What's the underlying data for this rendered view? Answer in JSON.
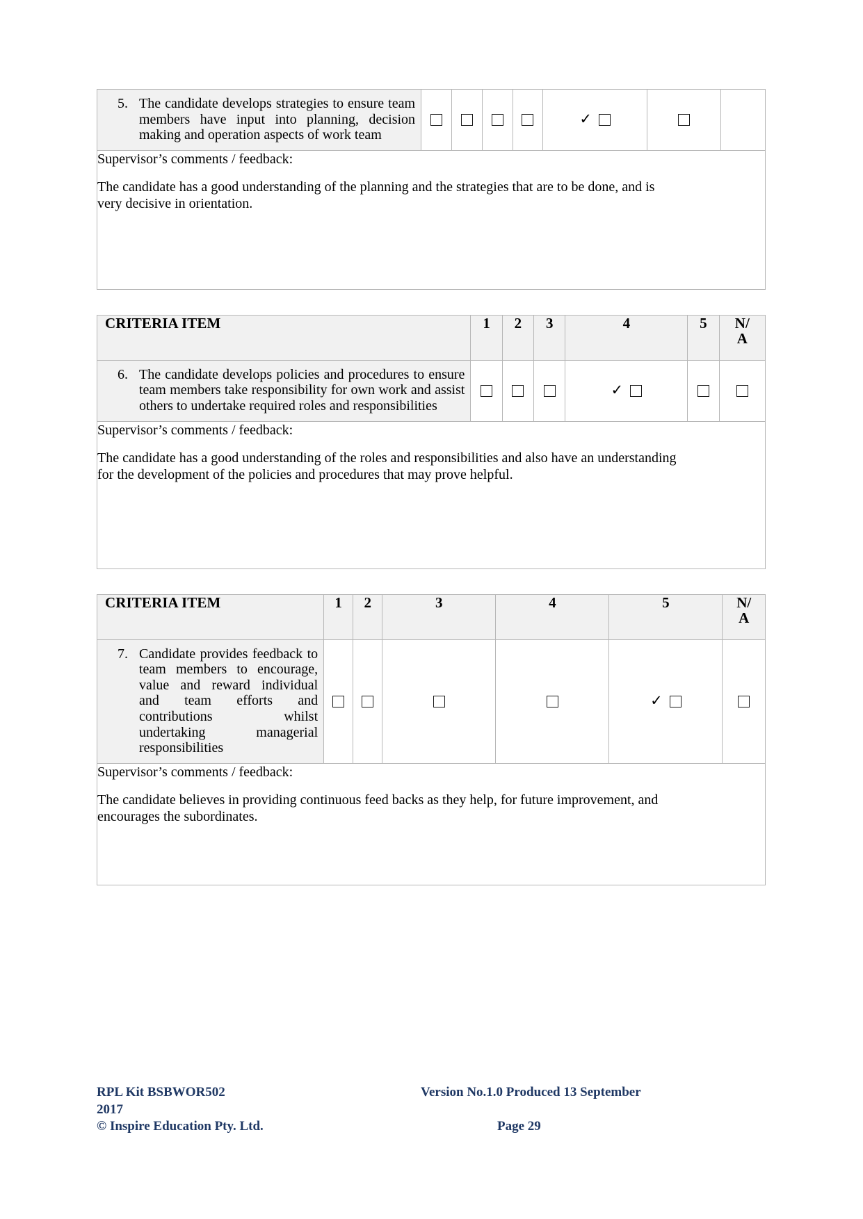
{
  "document": {
    "columns_header": {
      "criteria_label": "CRITERIA ITEM",
      "c1": "1",
      "c2": "2",
      "c3": "3",
      "c4": "4",
      "c5": "5",
      "cna": "N/\nA"
    },
    "tick_glyph": "✓",
    "comments_label": "Supervisor’s comments / feedback:",
    "sections": [
      {
        "has_header": false,
        "number": "5.",
        "criteria": "The candidate develops strategies to ensure team members have input into planning, decision making and operation aspects of work team",
        "selected": "4",
        "comments_label": "Supervisor’s comments / feedback:",
        "comments": "The candidate has a good understanding of the planning and the strategies that are to be done, and is very decisive in orientation."
      },
      {
        "has_header": true,
        "number": "6.",
        "criteria": "The candidate develops policies and procedures to ensure team members take responsibility for own work and assist others to undertake required roles and responsibilities",
        "selected": "4",
        "comments_label": "Supervisor’s comments / feedback:",
        "comments": "The candidate has a good understanding of the roles and responsibilities and also have an understanding for the development of the policies and procedures that may prove helpful."
      },
      {
        "has_header": true,
        "number": "7.",
        "criteria": "Candidate provides feedback to team members to encourage, value and reward individual and team efforts and contributions whilst undertaking managerial responsibilities",
        "selected": "5",
        "comments_label": "Supervisor’s comments / feedback:",
        "comments": "The candidate believes in providing continuous feed backs as they help, for future improvement, and encourages the subordinates."
      }
    ],
    "footer": {
      "kit": "RPL Kit BSBWOR502",
      "version": "Version No.1.0 Produced 13 September",
      "year": "2017",
      "copyright": "© Inspire Education Pty. Ltd.",
      "page": "Page 29",
      "color": "#1f3864"
    }
  }
}
